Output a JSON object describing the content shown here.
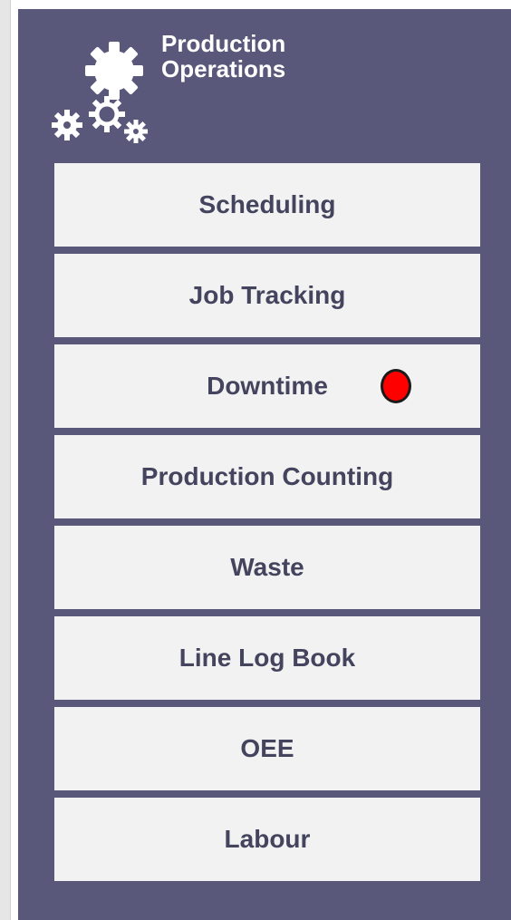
{
  "header": {
    "title_line1": "Production",
    "title_line2": "Operations",
    "icon": "gears-icon"
  },
  "menu": {
    "items": [
      {
        "label": "Scheduling"
      },
      {
        "label": "Job Tracking"
      },
      {
        "label": "Downtime",
        "status": "alert",
        "status_color": "#ff0000"
      },
      {
        "label": "Production Counting"
      },
      {
        "label": "Waste"
      },
      {
        "label": "Line Log Book"
      },
      {
        "label": "OEE"
      },
      {
        "label": "Labour"
      }
    ]
  },
  "colors": {
    "panel_background": "#5a587a",
    "item_background": "#f2f2f2",
    "item_text": "#44445e",
    "header_text": "#ffffff"
  }
}
